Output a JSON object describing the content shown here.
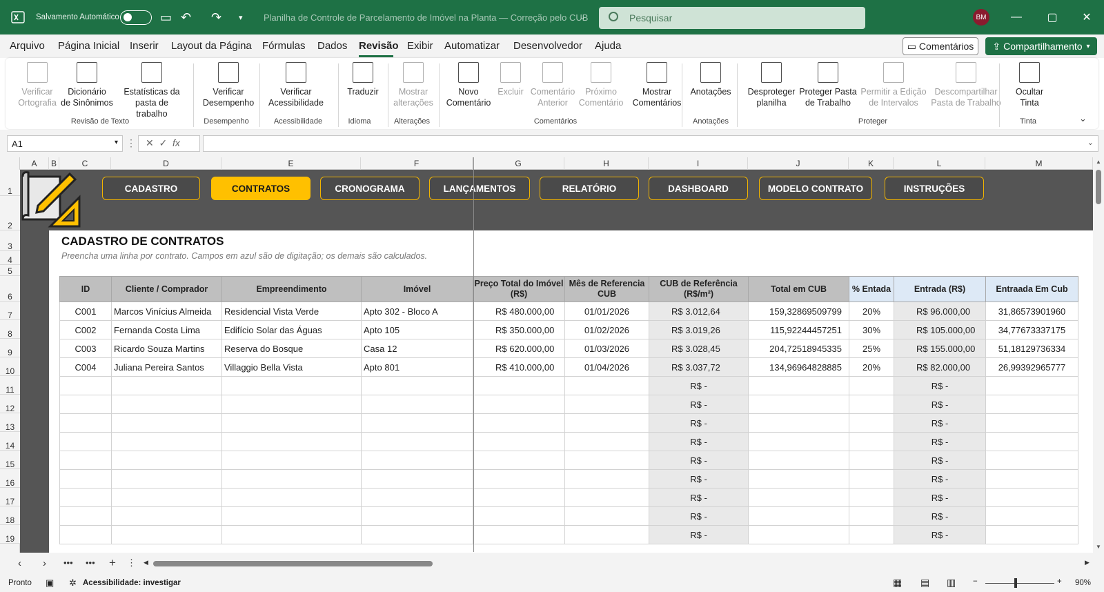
{
  "titlebar": {
    "autosave_label": "Salvamento Automático",
    "doc_title": "Planilha de Controle de Parcelamento de Imóvel na Planta — Correção pelo CUB",
    "search_placeholder": "Pesquisar",
    "user_initials": "BM"
  },
  "menu": {
    "items": [
      "Arquivo",
      "Página Inicial",
      "Inserir",
      "Layout da Página",
      "Fórmulas",
      "Dados",
      "Revisão",
      "Exibir",
      "Automatizar",
      "Desenvolvedor",
      "Ajuda"
    ],
    "active": "Revisão",
    "comments_label": "Comentários",
    "share_label": "Compartilhamento"
  },
  "ribbon": {
    "buttons": [
      {
        "l1": "Verificar",
        "l2": "Ortografia",
        "disabled": true
      },
      {
        "l1": "Dicionário",
        "l2": "de Sinônimos",
        "disabled": false
      },
      {
        "l1": "Estatísticas da",
        "l2": "pasta de trabalho",
        "disabled": false
      },
      {
        "l1": "Verificar",
        "l2": "Desempenho",
        "disabled": false
      },
      {
        "l1": "Verificar",
        "l2": "Acessibilidade",
        "disabled": false
      },
      {
        "l1": "Traduzir",
        "l2": "",
        "disabled": false
      },
      {
        "l1": "Mostrar",
        "l2": "alterações",
        "disabled": true
      },
      {
        "l1": "Novo",
        "l2": "Comentário",
        "disabled": false
      },
      {
        "l1": "Excluir",
        "l2": "",
        "disabled": true
      },
      {
        "l1": "Comentário",
        "l2": "Anterior",
        "disabled": true
      },
      {
        "l1": "Próximo",
        "l2": "Comentário",
        "disabled": true
      },
      {
        "l1": "Mostrar",
        "l2": "Comentários",
        "disabled": false
      },
      {
        "l1": "Anotações",
        "l2": "",
        "disabled": false
      },
      {
        "l1": "Desproteger",
        "l2": "planilha",
        "disabled": false
      },
      {
        "l1": "Proteger Pasta",
        "l2": "de Trabalho",
        "disabled": false
      },
      {
        "l1": "Permitir a Edição",
        "l2": "de Intervalos",
        "disabled": true
      },
      {
        "l1": "Descompartilhar",
        "l2": "Pasta de Trabalho",
        "disabled": true
      },
      {
        "l1": "Ocultar",
        "l2": "Tinta",
        "disabled": false
      }
    ],
    "groups": [
      "Revisão de Texto",
      "Desempenho",
      "Acessibilidade",
      "Idioma",
      "Alterações",
      "Comentários",
      "Anotações",
      "Proteger",
      "Tinta"
    ]
  },
  "formula_bar": {
    "name_box": "A1",
    "fx": "fx",
    "formula": ""
  },
  "columns": [
    "A",
    "B",
    "C",
    "D",
    "E",
    "F",
    "G",
    "H",
    "I",
    "J",
    "K",
    "L",
    "M"
  ],
  "rows": [
    "1",
    "2",
    "3",
    "4",
    "5",
    "6",
    "7",
    "8",
    "9",
    "10",
    "11",
    "12",
    "13",
    "14",
    "15",
    "16",
    "17",
    "18",
    "19"
  ],
  "nav_buttons": [
    "CADASTRO",
    "CONTRATOS",
    "CRONOGRAMA",
    "LANÇAMENTOS",
    "RELATÓRIO",
    "DASHBOARD",
    "MODELO CONTRATO",
    "INSTRUÇÕES"
  ],
  "nav_active": "CONTRATOS",
  "sheet": {
    "title": "CADASTRO DE CONTRATOS",
    "subtitle": "Preencha uma linha por contrato. Campos em azul são de digitação; os demais são calculados.",
    "headers": [
      "ID",
      "Cliente / Comprador",
      "Empreendimento",
      "Imóvel",
      "Preço Total do Imóvel (R$)",
      "Mês de Referencia CUB",
      "CUB de Referência (R$/m²)",
      "Total em CUB",
      "% Entada",
      "Entrada (R$)",
      "Entraada Em Cub"
    ],
    "rows": [
      [
        "C001",
        "Marcos Vinícius Almeida",
        "Residencial Vista Verde",
        "Apto 302 - Bloco A",
        "R$ 480.000,00",
        "01/01/2026",
        "R$ 3.012,64",
        "159,32869509799",
        "20%",
        "R$ 96.000,00",
        "31,86573901960"
      ],
      [
        "C002",
        "Fernanda Costa Lima",
        "Edifício Solar das Águas",
        "Apto 105",
        "R$ 350.000,00",
        "01/02/2026",
        "R$ 3.019,26",
        "115,92244457251",
        "30%",
        "R$ 105.000,00",
        "34,77673337175"
      ],
      [
        "C003",
        "Ricardo Souza Martins",
        "Reserva do Bosque",
        "Casa 12",
        "R$ 620.000,00",
        "01/03/2026",
        "R$ 3.028,45",
        "204,72518945335",
        "25%",
        "R$ 155.000,00",
        "51,18129736334"
      ],
      [
        "C004",
        "Juliana Pereira Santos",
        "Villaggio Bella Vista",
        "Apto 801",
        "R$ 410.000,00",
        "01/04/2026",
        "R$ 3.037,72",
        "134,96964828885",
        "20%",
        "R$ 82.000,00",
        "26,99392965777"
      ]
    ],
    "empty_value": "R$ -",
    "empty_partial": "R$ -"
  },
  "status": {
    "ready": "Pronto",
    "accessibility": "Acessibilidade: investigar",
    "zoom": "90%"
  },
  "colors": {
    "brand": "#1e7145",
    "nav_active": "#ffc000",
    "dark_band": "#555555"
  }
}
